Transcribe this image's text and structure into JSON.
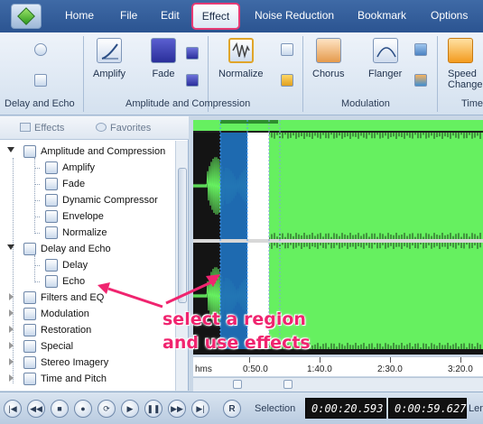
{
  "menubar": {
    "tabs": [
      "Home",
      "File",
      "Edit",
      "Effect",
      "Noise Reduction",
      "Bookmark",
      "Options"
    ],
    "active_tab": "Effect"
  },
  "ribbon": {
    "buttons": {
      "amplify": "Amplify",
      "fade": "Fade",
      "normalize": "Normalize",
      "chorus": "Chorus",
      "flanger": "Flanger",
      "speed_line1": "Speed",
      "speed_line2": "Change"
    },
    "groups": {
      "delay_echo": "Delay and Echo",
      "amplitude": "Amplitude and Compression",
      "modulation": "Modulation",
      "time": "Time"
    }
  },
  "left_panel": {
    "tabs": {
      "effects": "Effects",
      "favorites": "Favorites"
    },
    "tree": [
      {
        "label": "Amplitude and Compression",
        "level": 0,
        "expanded": true
      },
      {
        "label": "Amplify",
        "level": 1
      },
      {
        "label": "Fade",
        "level": 1
      },
      {
        "label": "Dynamic Compressor",
        "level": 1
      },
      {
        "label": "Envelope",
        "level": 1
      },
      {
        "label": "Normalize",
        "level": 1
      },
      {
        "label": "Delay and Echo",
        "level": 0,
        "expanded": true
      },
      {
        "label": "Delay",
        "level": 1
      },
      {
        "label": "Echo",
        "level": 1
      },
      {
        "label": "Filters and EQ",
        "level": 0,
        "expanded": false
      },
      {
        "label": "Modulation",
        "level": 0,
        "expanded": false
      },
      {
        "label": "Restoration",
        "level": 0,
        "expanded": false
      },
      {
        "label": "Special",
        "level": 0,
        "expanded": false
      },
      {
        "label": "Stereo Imagery",
        "level": 0,
        "expanded": false
      },
      {
        "label": "Time and Pitch",
        "level": 0,
        "expanded": false
      }
    ]
  },
  "ruler": {
    "labels": [
      "hms",
      "0:50.0",
      "1:40.0",
      "2:30.0",
      "3:20.0"
    ]
  },
  "transport": {
    "selection_label": "Selection",
    "selection_start": "0:00:20.593",
    "selection_end": "0:00:59.627",
    "length_label": "Leng"
  },
  "annotation": {
    "line1": "select a region",
    "line2": "and use effects",
    "color": "#f0246f"
  },
  "colors": {
    "waveform": "#66f060",
    "selection": "#1f6fb8",
    "accent": "#e63a74"
  }
}
